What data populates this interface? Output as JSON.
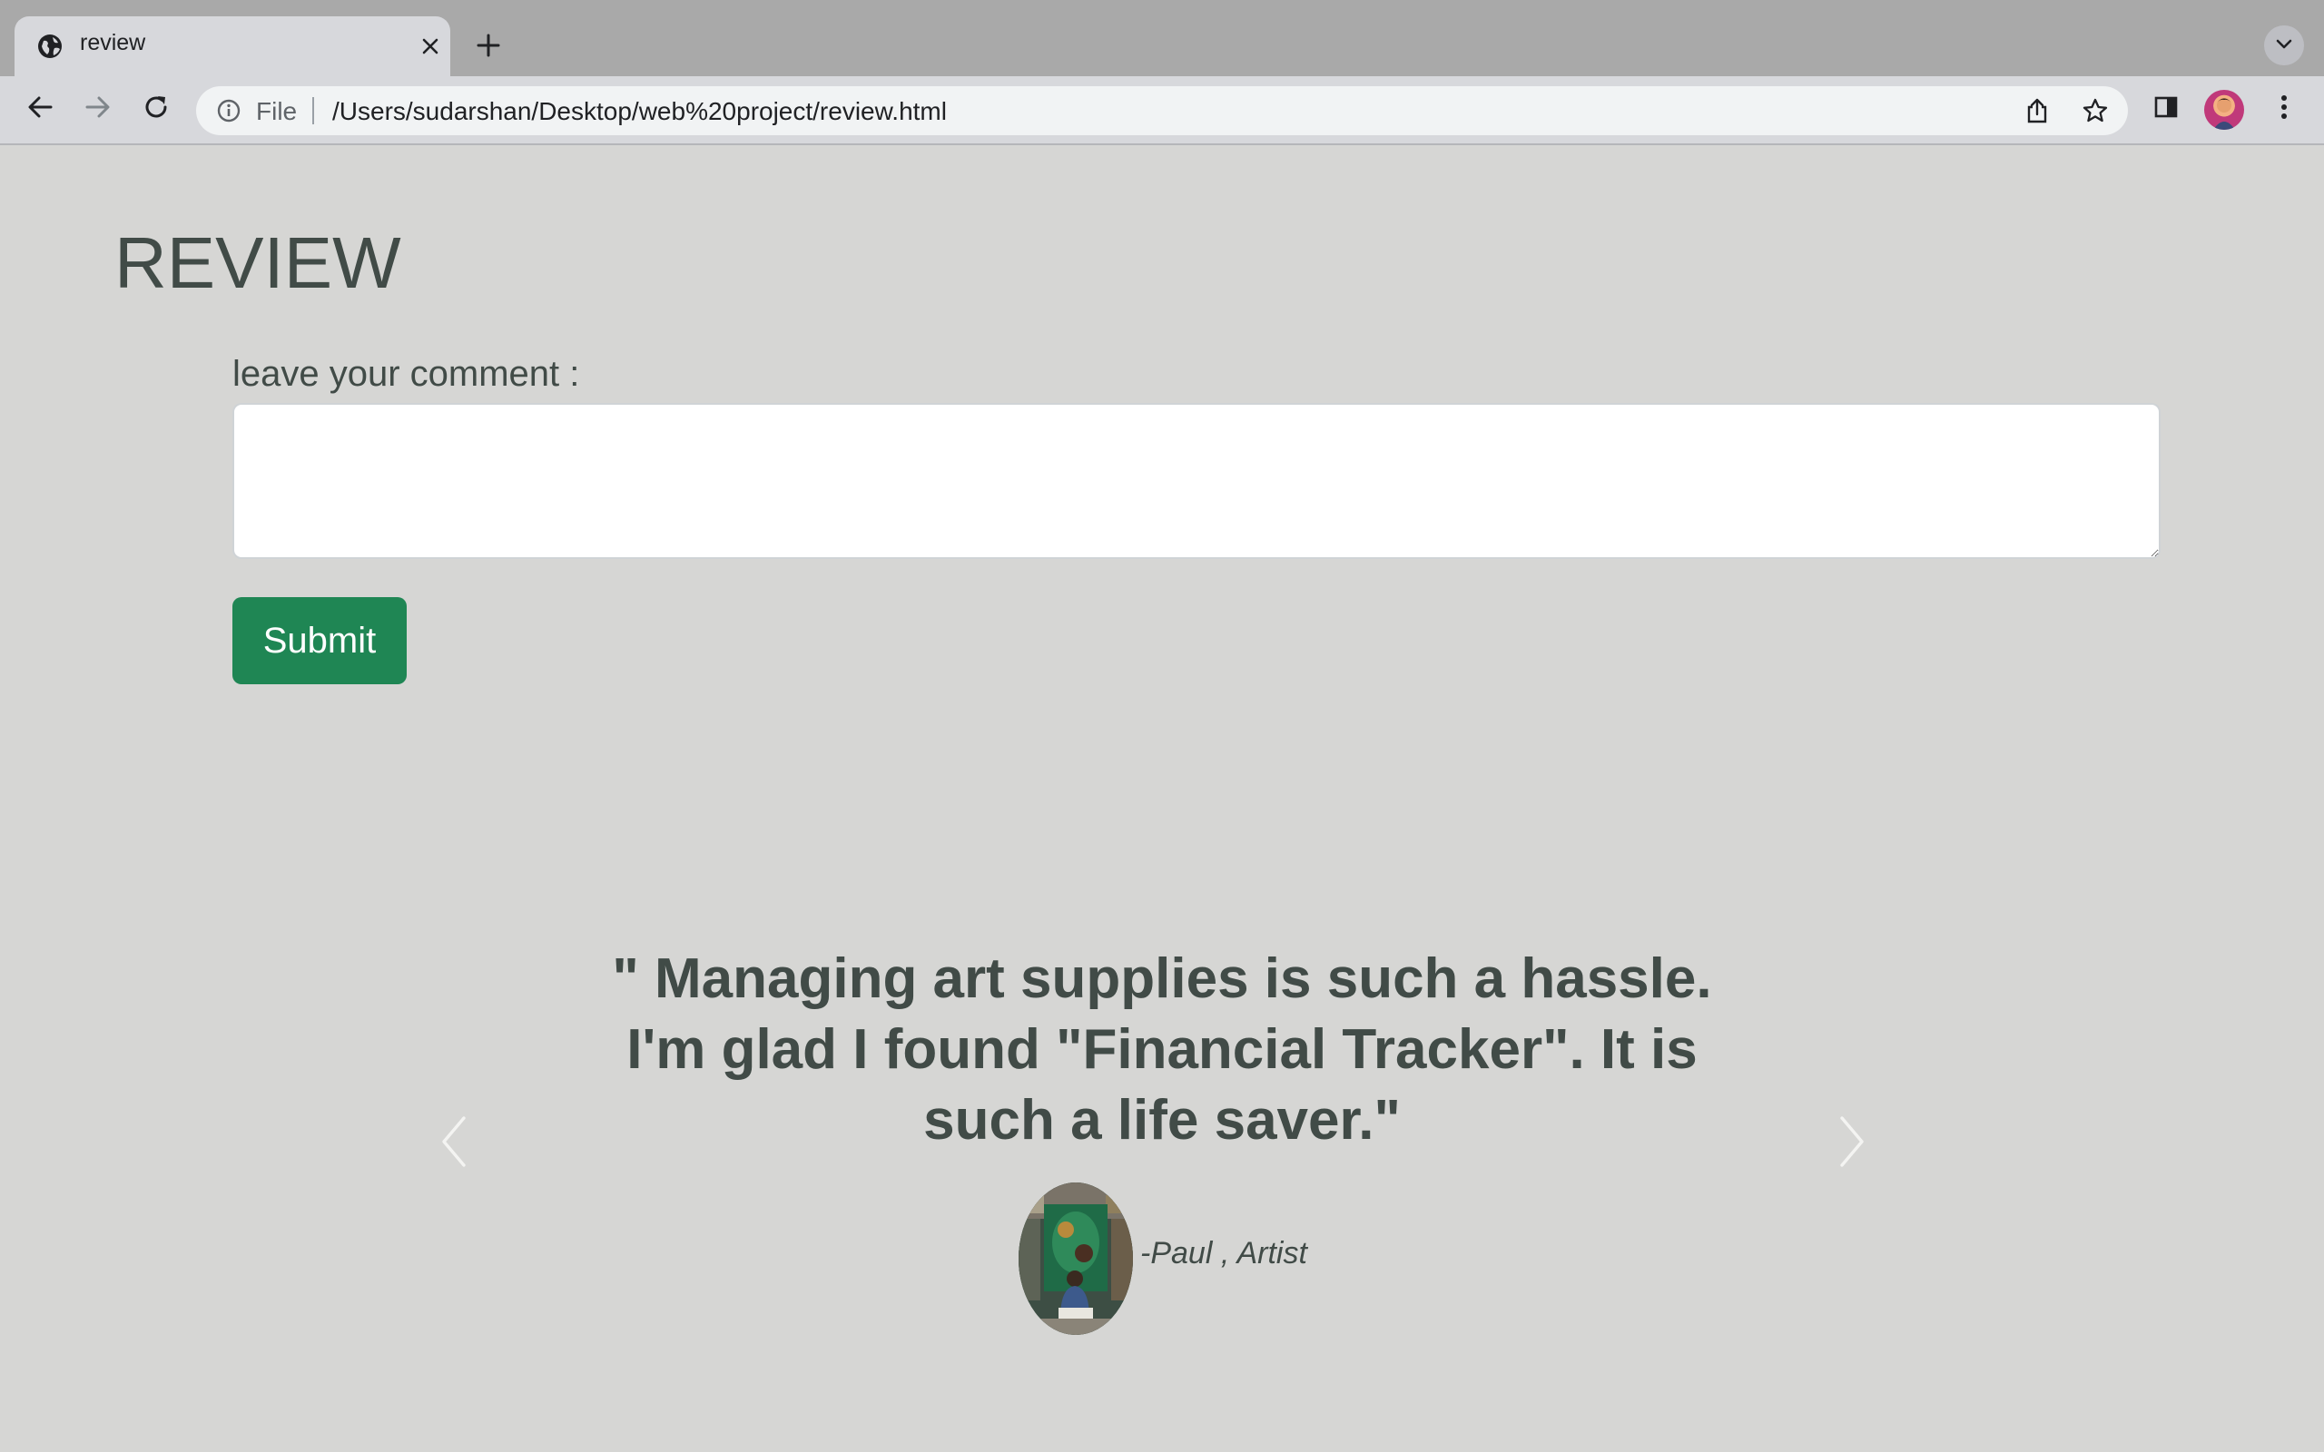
{
  "browser": {
    "tab_title": "review",
    "omnibox": {
      "scheme": "File",
      "url": "/Users/sudarshan/Desktop/web%20project/review.html"
    },
    "icons": [
      "globe-icon",
      "close-icon",
      "plus-icon",
      "chevron-down-icon",
      "back-arrow-icon",
      "forward-arrow-icon",
      "reload-icon",
      "info-icon",
      "share-icon",
      "star-icon",
      "side-panel-icon",
      "profile-avatar",
      "kebab-menu-icon"
    ]
  },
  "page": {
    "heading": "REVIEW",
    "comment_label": "leave your comment :",
    "comment_value": "",
    "submit_label": "Submit",
    "testimonial": {
      "quote": "\" Managing art supplies is such a hassle. I'm glad I found \"Financial Tracker\". It is such a life saver.\"",
      "author": "-Paul , Artist"
    }
  },
  "colors": {
    "page_background": "#d6d6d4",
    "text": "#414b47",
    "submit_button": "#1f8654",
    "tabstrip": "#a9a9a9",
    "toolbar": "#d7d8dc"
  }
}
